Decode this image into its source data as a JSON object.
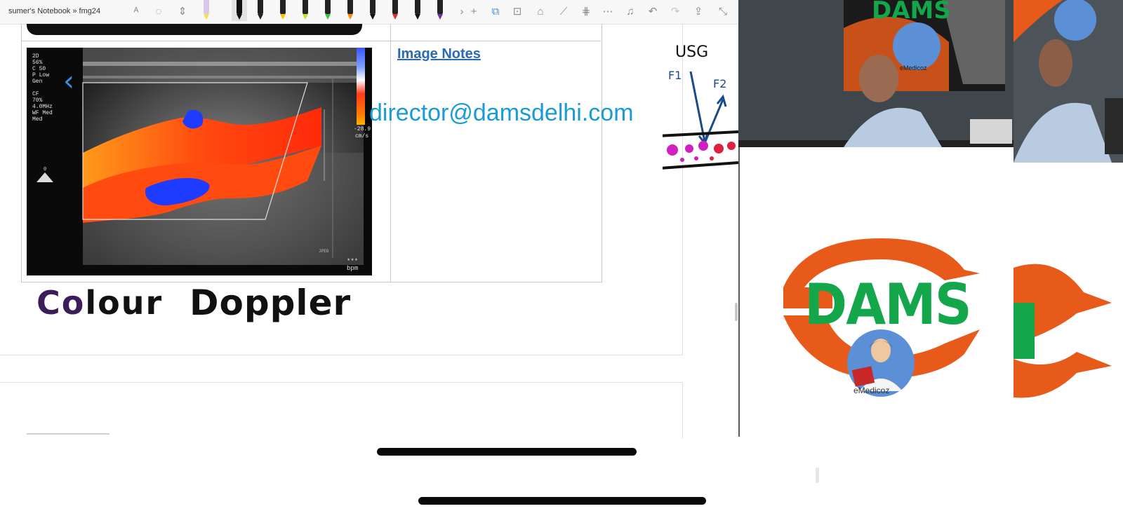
{
  "toolbar": {
    "breadcrumb": "sumer's Notebook » fmg24",
    "icons": [
      "text-format-icon",
      "lasso-select-icon",
      "add-space-icon",
      "eraser-icon",
      "more-pens-icon",
      "add-pen-icon",
      "shapes-icon",
      "copy-ink-icon",
      "ink-to-text-icon",
      "ruler-icon",
      "ink-replay-icon",
      "more-icon",
      "notification-icon",
      "undo-icon",
      "redo-icon",
      "share-icon",
      "fullscreen-icon"
    ],
    "pen_colors": [
      "#f7e04a",
      "#111111",
      "#111111",
      "#f5c400",
      "#c8e020",
      "#3cc43c",
      "#ff8a00",
      "#111111",
      "#e03030",
      "#111111",
      "#7030a0",
      "#3cc43c"
    ]
  },
  "page": {
    "image_notes_link": "Image Notes",
    "email_watermark": "director@damsdelhi.com",
    "handwriting": {
      "word1_first": "Co",
      "word1_rest": "lour",
      "word2": "Doppler",
      "usg_label": "USG",
      "f1_label": "F1",
      "f2_label": "F2"
    },
    "ultrasound": {
      "readout": "2D\n56%\nC 50\nP Low\nGen\n\nCF\n70%\n4.0MHz\nWF Med\nMed",
      "scale_value": "-28.9",
      "scale_unit": "cm/s",
      "bpm_label": "*** bpm",
      "jpeg_label": "JPEG",
      "probe_mark": "0"
    }
  },
  "video": {
    "logo_text": "DAMS",
    "logo_subtext": "eMedicoz",
    "badge_text": "eMedicoz",
    "colors": {
      "logo_orange": "#e85a1a",
      "logo_green": "#14a64a"
    }
  }
}
